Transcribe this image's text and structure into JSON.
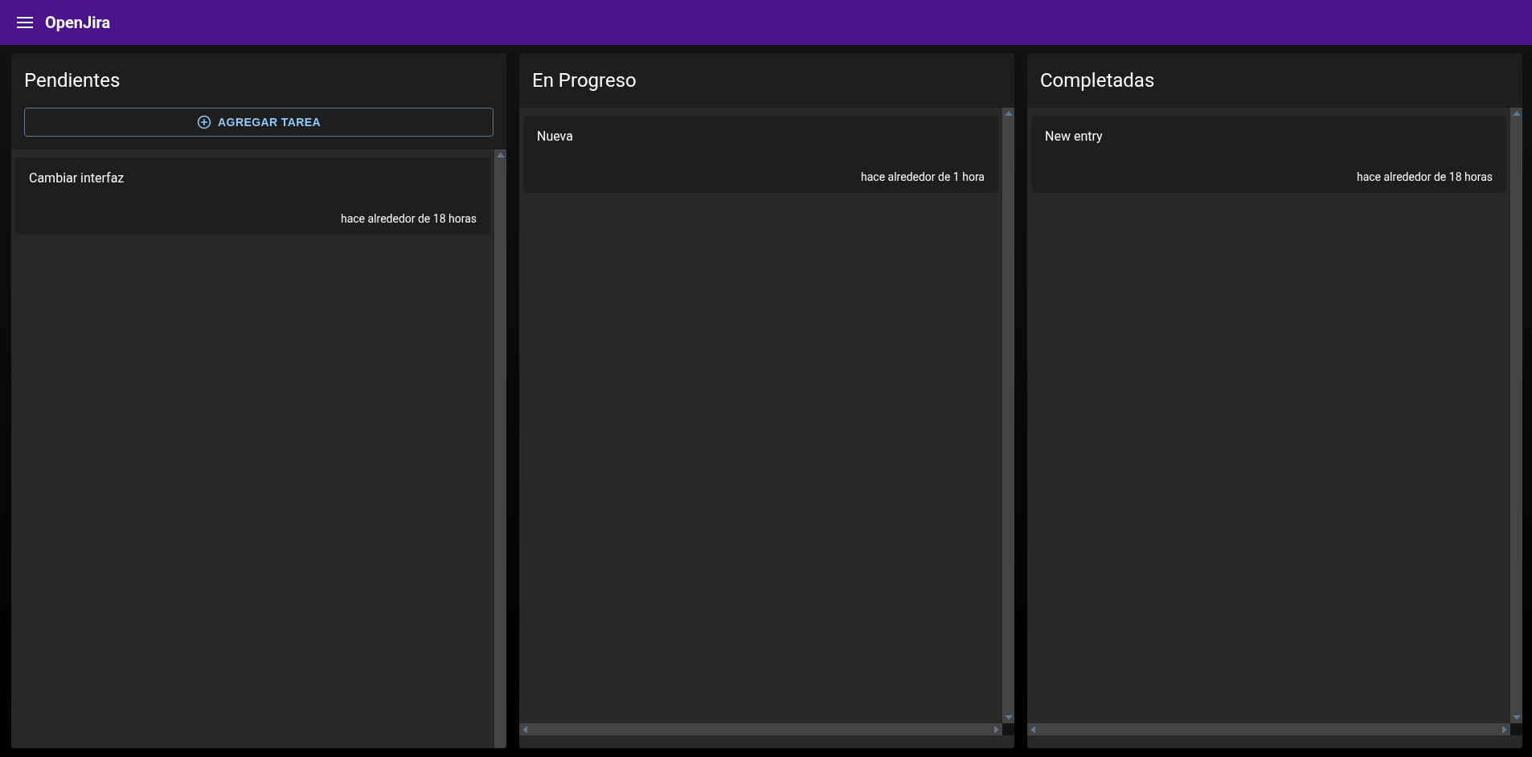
{
  "app_bar": {
    "title": "OpenJira"
  },
  "columns": [
    {
      "title": "Pendientes",
      "add_button": "AGREGAR TAREA",
      "entries": [
        {
          "description": "Cambiar interfaz",
          "time": "hace alrededor de 18 horas"
        }
      ]
    },
    {
      "title": "En Progreso",
      "entries": [
        {
          "description": "Nueva",
          "time": "hace alrededor de 1 hora"
        }
      ]
    },
    {
      "title": "Completadas",
      "entries": [
        {
          "description": "New entry",
          "time": "hace alrededor de 18 horas"
        }
      ]
    }
  ]
}
